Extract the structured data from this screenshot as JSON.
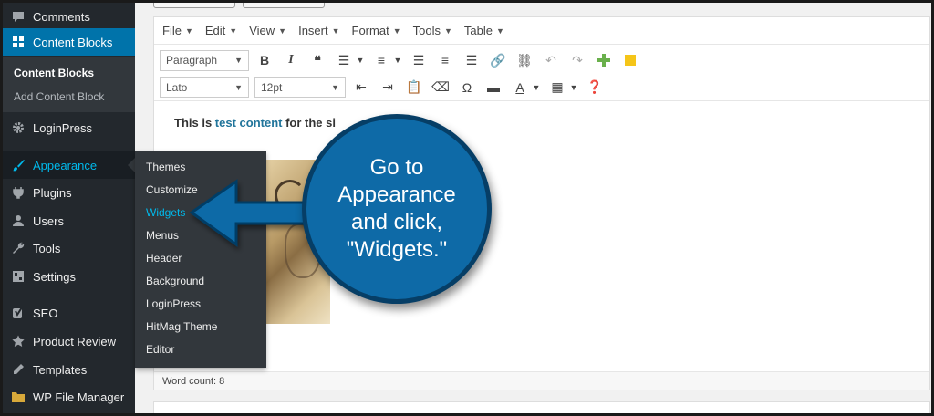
{
  "sidebar": {
    "items": [
      {
        "label": "Comments",
        "icon": "comment-icon"
      },
      {
        "label": "Content Blocks",
        "icon": "grid-icon"
      },
      {
        "label": "LoginPress",
        "icon": "gear-icon"
      },
      {
        "label": "Appearance",
        "icon": "paintbrush-icon"
      },
      {
        "label": "Plugins",
        "icon": "plug-icon"
      },
      {
        "label": "Users",
        "icon": "user-icon"
      },
      {
        "label": "Tools",
        "icon": "wrench-icon"
      },
      {
        "label": "Settings",
        "icon": "settings-icon"
      },
      {
        "label": "SEO",
        "icon": "yoast-icon"
      },
      {
        "label": "Product Review",
        "icon": "star-icon"
      },
      {
        "label": "Templates",
        "icon": "pencil-icon"
      },
      {
        "label": "WP File Manager",
        "icon": "folder-icon"
      }
    ],
    "submenu": {
      "current": "Content Blocks",
      "add": "Add Content Block"
    }
  },
  "flyout": {
    "items": [
      "Themes",
      "Customize",
      "Widgets",
      "Menus",
      "Header",
      "Background",
      "LoginPress",
      "HitMag Theme",
      "Editor"
    ],
    "active": "Widgets"
  },
  "editor": {
    "menus": [
      "File",
      "Edit",
      "View",
      "Insert",
      "Format",
      "Tools",
      "Table"
    ],
    "format_select": "Paragraph",
    "font_select": "Lato",
    "size_select": "12pt",
    "content": {
      "before": "This is ",
      "link": "test content",
      "after": " for the si"
    },
    "word_count": "Word count: 8"
  },
  "callout": {
    "text": "Go to\nAppearance\nand click,\n\"Widgets.\""
  },
  "colors": {
    "sidebar_bg": "#23282d",
    "accent": "#0073aa",
    "highlight": "#00b9eb",
    "callout": "#0e6aa7"
  }
}
